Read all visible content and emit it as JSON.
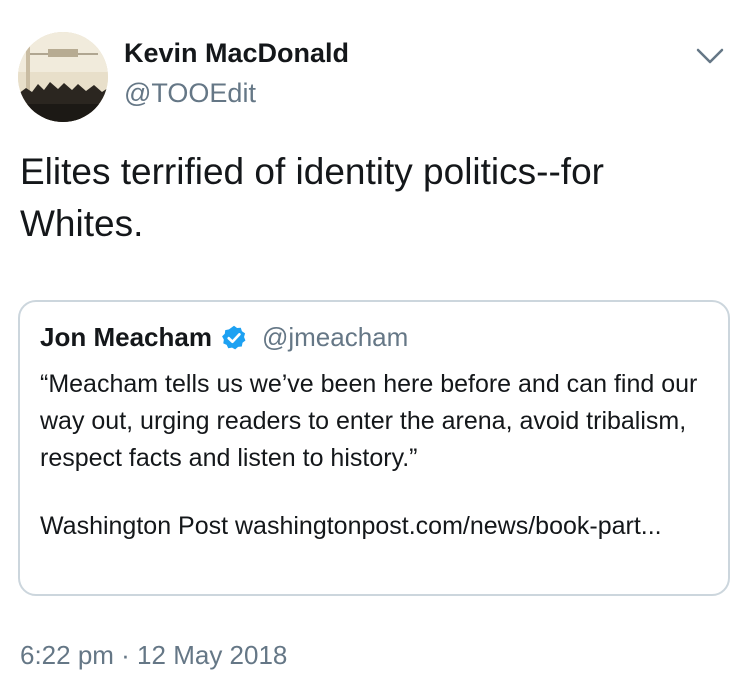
{
  "tweet": {
    "author": {
      "display_name": "Kevin MacDonald",
      "handle": "@TOOEdit",
      "avatar_icon": "avatar-image"
    },
    "menu_icon": "chevron-down-icon",
    "text": "Elites terrified of identity politics--for Whites.",
    "timestamp": "6:22 pm · 12 May 2018"
  },
  "quoted_tweet": {
    "display_name": "Jon Meacham",
    "verified": true,
    "verified_icon": "verified-badge-icon",
    "handle": "@jmeacham",
    "text": "“Meacham tells us we’ve been here before and can find our way out, urging readers to enter the arena, avoid tribalism, respect facts and listen to history.”",
    "source_line": "Washington Post washingtonpost.com/news/book-part..."
  },
  "colors": {
    "primary_text": "#14171a",
    "secondary_text": "#657786",
    "border": "#ccd6dd",
    "verified_blue": "#1da1f2"
  }
}
